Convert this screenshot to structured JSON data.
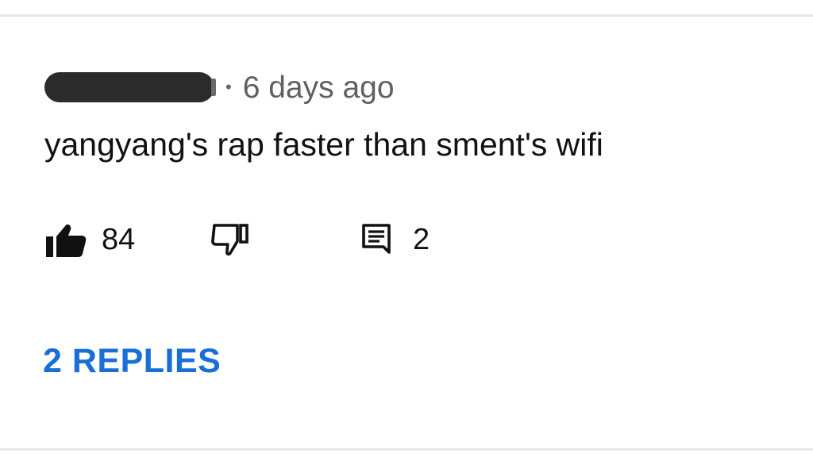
{
  "comment": {
    "author": "",
    "separator": "•",
    "timestamp": "6 days ago",
    "text": "yangyang's rap faster than sment's wifi"
  },
  "actions": {
    "likes": "84",
    "replies_count": "2"
  },
  "replies_link": "2 REPLIES",
  "colors": {
    "text": "#111111",
    "secondary": "#606060",
    "link": "#1a6fd6",
    "redaction": "#2b2b2b",
    "divider": "#e6e6e6"
  },
  "icons": {
    "like": "thumbs-up-filled-icon",
    "dislike": "thumbs-down-outline-icon",
    "reply": "comment-icon"
  }
}
